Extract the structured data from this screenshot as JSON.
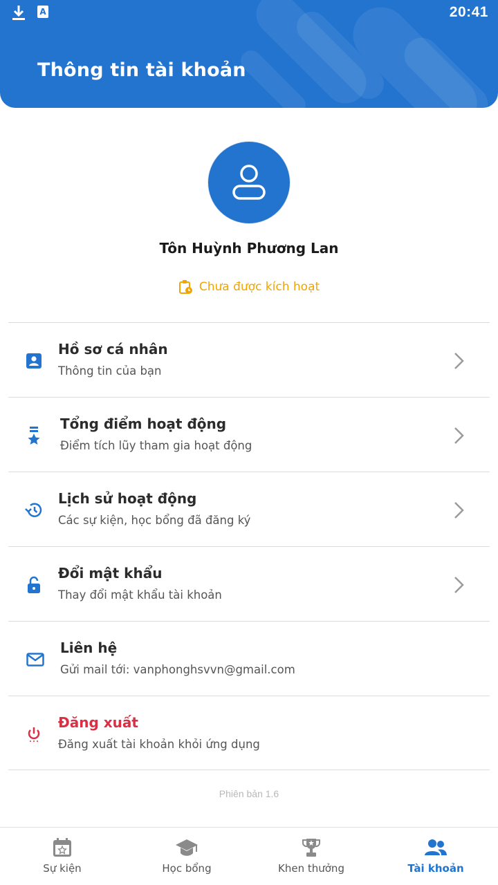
{
  "status_bar": {
    "time": "20:41",
    "icons": [
      "download-icon",
      "app-a-icon"
    ]
  },
  "header": {
    "title": "Thông tin tài khoản"
  },
  "profile": {
    "name": "Tôn Huỳnh Phương Lan",
    "status": "Chưa được kích hoạt",
    "status_color": "#f0a500"
  },
  "menu": {
    "items": [
      {
        "title": "Hồ sơ cá nhân",
        "subtitle": "Thông tin của bạn",
        "icon": "profile-card-icon"
      },
      {
        "title": "Tổng điểm hoạt động",
        "subtitle": "Điểm tích lũy tham gia hoạt động",
        "icon": "medal-icon"
      },
      {
        "title": "Lịch sử hoạt động",
        "subtitle": "Các sự kiện, học bổng đã đăng ký",
        "icon": "history-icon"
      },
      {
        "title": "Đổi mật khẩu",
        "subtitle": "Thay đổi mật khẩu tài khoản",
        "icon": "lock-icon"
      },
      {
        "title": "Liên hệ",
        "subtitle": "Gửi mail tới: vanphonghsvvn@gmail.com",
        "icon": "mail-icon"
      },
      {
        "title": "Đăng xuất",
        "subtitle": "Đăng xuất tài khoản khỏi ứng dụng",
        "icon": "power-icon"
      }
    ]
  },
  "version": "Phiên bản 1.6",
  "bottom_nav": {
    "items": [
      {
        "label": "Sự kiện",
        "icon": "calendar-star-icon"
      },
      {
        "label": "Học bổng",
        "icon": "graduation-cap-icon"
      },
      {
        "label": "Khen thưởng",
        "icon": "trophy-icon"
      },
      {
        "label": "Tài khoản",
        "icon": "users-icon",
        "active": true
      }
    ]
  },
  "colors": {
    "primary": "#2274cf",
    "danger": "#d93045",
    "warning": "#f0a500"
  }
}
